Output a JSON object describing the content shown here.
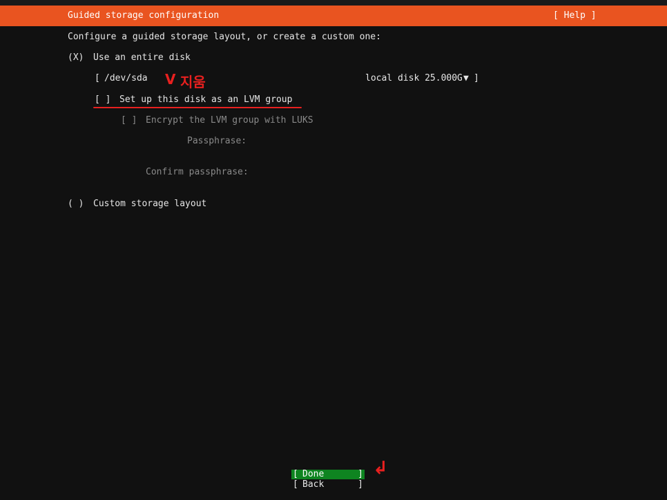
{
  "header": {
    "title": "Guided storage configuration",
    "help_label": "[ Help ]"
  },
  "intro": "Configure a guided storage layout, or create a custom one:",
  "entire_disk": {
    "radio": "(X)",
    "label": "Use an entire disk",
    "disk_select": {
      "open": "[",
      "device": "/dev/sda",
      "info": "local disk 25.000G",
      "arrow": "▼",
      "close": "]"
    },
    "lvm": {
      "checkbox": "[ ]",
      "label": "Set up this disk as an LVM group"
    },
    "encrypt": {
      "checkbox": "[ ]",
      "label": "Encrypt the LVM group with LUKS"
    },
    "passphrase_label": "Passphrase:",
    "confirm_label": "Confirm passphrase:"
  },
  "custom": {
    "radio": "( )",
    "label": "Custom storage layout"
  },
  "annotations": {
    "check": "V",
    "text": "지움",
    "enter_arrow": "↲",
    "color": "#e8201f"
  },
  "buttons": {
    "done": "Done",
    "back": "Back",
    "open": "[",
    "close": "]"
  },
  "colors": {
    "accent": "#e95420",
    "done_bg": "#0e8420",
    "background": "#111111"
  }
}
